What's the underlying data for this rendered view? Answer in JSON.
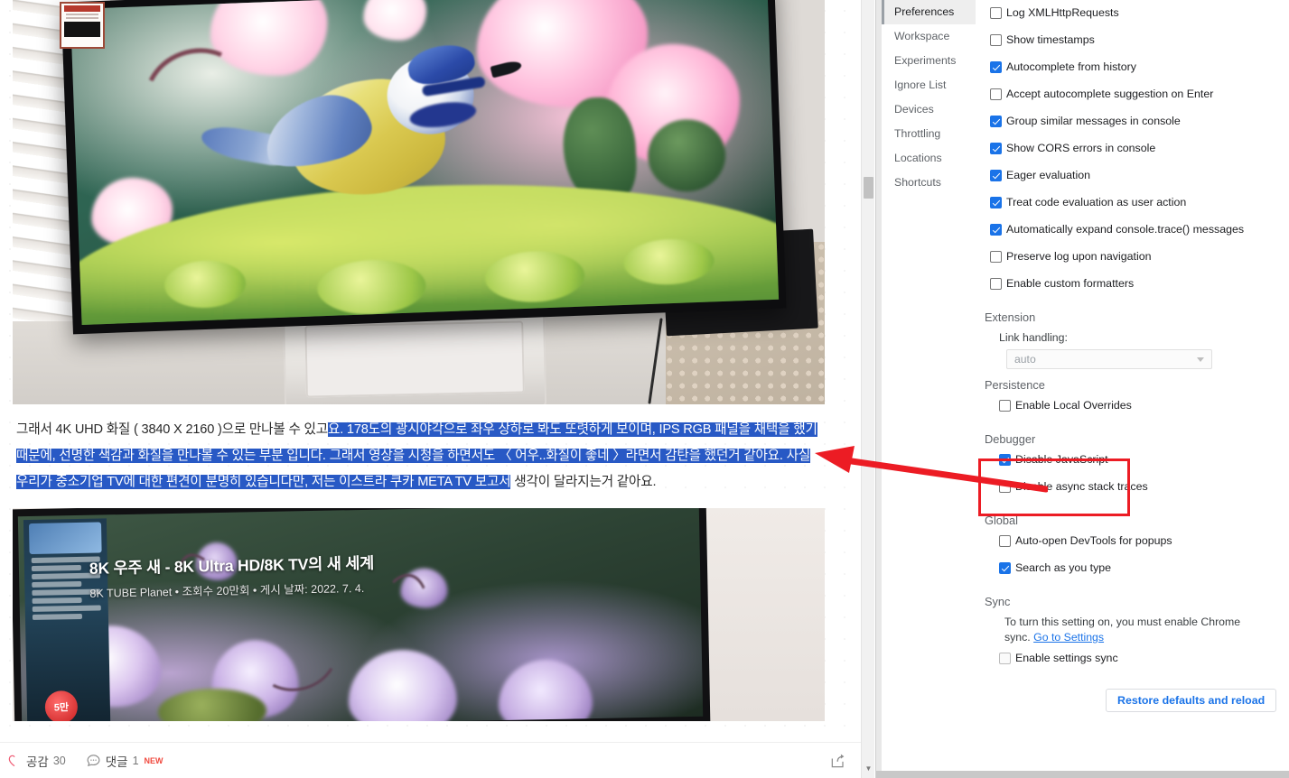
{
  "blog": {
    "photo1": {
      "alt_description": "Photograph of an LG TV on a white stand displaying a blue tit bird perched on green moss with pink cyclamen flowers"
    },
    "paragraph": {
      "before_selection": "그래서 4K UHD 화질 ( 3840 X 2160 )으로 만나볼 수 있고",
      "selected": "요. 178도의 광시야각으로 좌우 상하로 봐도 또렷하게 보이며, IPS RGB 패널을 채택을 했기 때문에, 선명한 색감과 화질을 만나볼 수 있는 부분 입니다. 그래서 영상을 시청을 하면서도 〈 어우..화질이 좋네 〉라면서 감탄을 했던거 같아요. 사실 우리가 중소기업 TV에 대한 편견이 분명히 있습니다만, 저는 이스트라 쿠카 META TV 보고서",
      "after_selection": " 생각이 달라지는거 같아요."
    },
    "photo2": {
      "video_title": "8K 우주 새 - 8K Ultra HD/8K TV의 새 세계",
      "video_meta": "8K TUBE Planet • 조회수 20만회 • 게시 날짜: 2022. 7. 4.",
      "badge": "5만",
      "alt_description": "TV screen showing a YouTube 8K video of purple cyclamen flowers"
    },
    "bottom_bar": {
      "like_icon": "heart-icon",
      "like_label": "공감",
      "like_count": "30",
      "comment_icon": "comment-icon",
      "comment_label": "댓글",
      "comment_count": "1",
      "comment_new_badge": "NEW",
      "share_icon": "share-icon"
    }
  },
  "devtools": {
    "nav": {
      "items": [
        {
          "label": "Preferences",
          "active": true
        },
        {
          "label": "Workspace",
          "active": false
        },
        {
          "label": "Experiments",
          "active": false
        },
        {
          "label": "Ignore List",
          "active": false
        },
        {
          "label": "Devices",
          "active": false
        },
        {
          "label": "Throttling",
          "active": false
        },
        {
          "label": "Locations",
          "active": false
        },
        {
          "label": "Shortcuts",
          "active": false
        }
      ]
    },
    "console_prefs": [
      {
        "label": "Log XMLHttpRequests",
        "checked": false
      },
      {
        "label": "Show timestamps",
        "checked": false
      },
      {
        "label": "Autocomplete from history",
        "checked": true
      },
      {
        "label": "Accept autocomplete suggestion on Enter",
        "checked": false
      },
      {
        "label": "Group similar messages in console",
        "checked": true
      },
      {
        "label": "Show CORS errors in console",
        "checked": true
      },
      {
        "label": "Eager evaluation",
        "checked": true
      },
      {
        "label": "Treat code evaluation as user action",
        "checked": true
      },
      {
        "label": "Automatically expand console.trace() messages",
        "checked": true
      },
      {
        "label": "Preserve log upon navigation",
        "checked": false
      },
      {
        "label": "Enable custom formatters",
        "checked": false
      }
    ],
    "extension": {
      "title": "Extension",
      "link_handling_label": "Link handling:",
      "link_handling_value": "auto"
    },
    "persistence": {
      "title": "Persistence",
      "items": [
        {
          "label": "Enable Local Overrides",
          "checked": false
        }
      ]
    },
    "debugger": {
      "title": "Debugger",
      "items": [
        {
          "label": "Disable JavaScript",
          "checked": true
        },
        {
          "label": "Disable async stack traces",
          "checked": false
        }
      ]
    },
    "global": {
      "title": "Global",
      "items": [
        {
          "label": "Auto-open DevTools for popups",
          "checked": false
        },
        {
          "label": "Search as you type",
          "checked": true
        }
      ]
    },
    "sync": {
      "title": "Sync",
      "description": "To turn this setting on, you must enable Chrome sync. ",
      "link_label": "Go to Settings",
      "checkbox_label": "Enable settings sync",
      "checkbox_checked": false
    },
    "restore_button": "Restore defaults and reload"
  },
  "annotation": {
    "box_target": "Debugger section with Disable JavaScript checkbox",
    "arrow_direction": "points left toward highlighted blog text",
    "color": "#ec1c24"
  },
  "colors": {
    "selection_blue": "#2859c5",
    "checkbox_blue": "#1a73e8",
    "link_blue": "#1a73e8",
    "annotation_red": "#ec1c24",
    "new_badge_red": "#f0493e",
    "heart_pink": "#ef5b73"
  }
}
